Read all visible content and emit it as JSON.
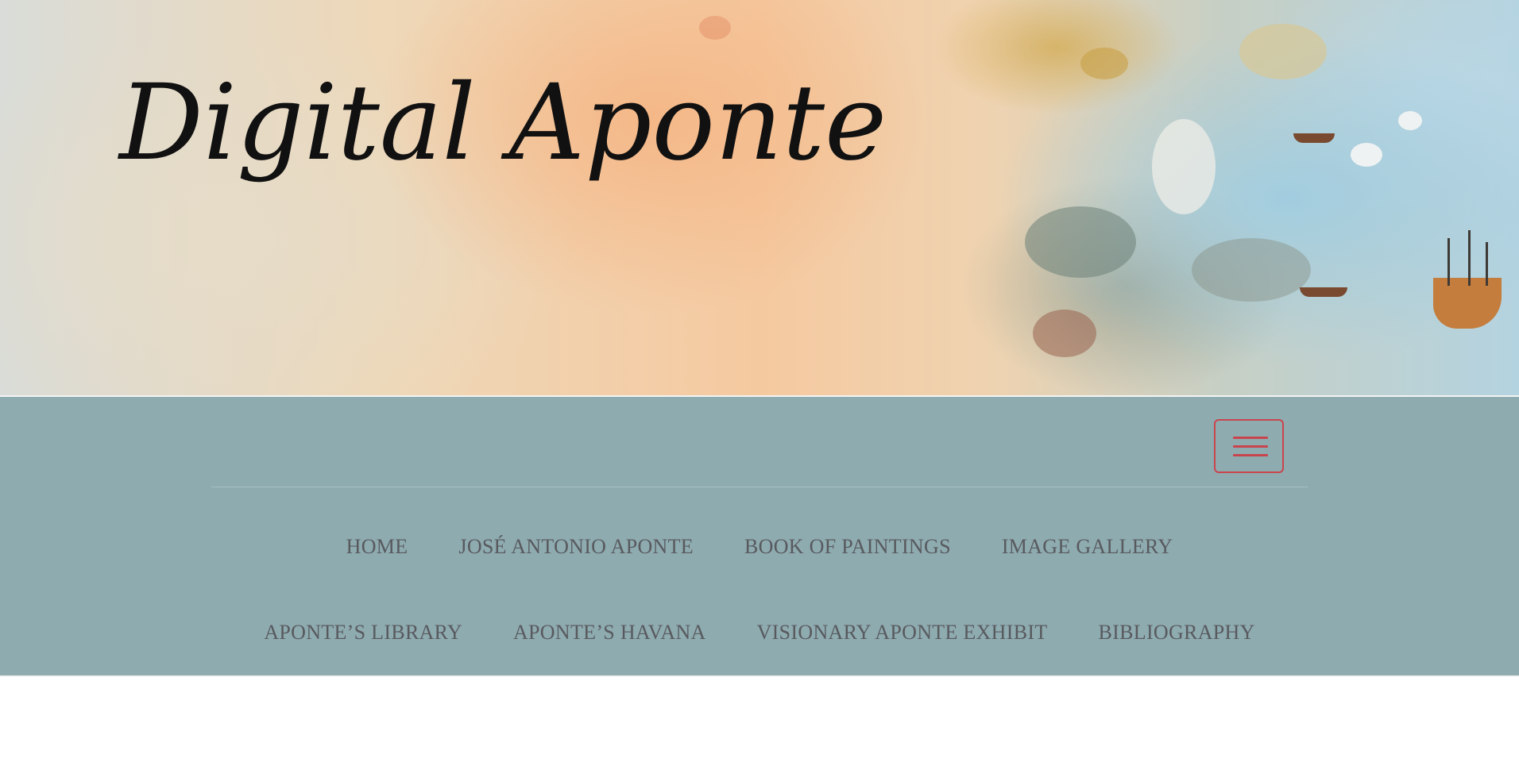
{
  "header": {
    "site_title": "Digital Aponte"
  },
  "navbar": {
    "toggle_icon": "hamburger-menu-icon",
    "accent_color": "#c9454d",
    "background_color": "#8eabb0",
    "link_color": "#585a5e",
    "links_row1": [
      {
        "label": "HOME"
      },
      {
        "label": "JOSÉ ANTONIO APONTE"
      },
      {
        "label": "BOOK OF PAINTINGS"
      },
      {
        "label": "IMAGE GALLERY"
      }
    ],
    "links_row2": [
      {
        "label": "APONTE’S LIBRARY"
      },
      {
        "label": "APONTE’S HAVANA"
      },
      {
        "label": "VISIONARY APONTE EXHIBIT"
      },
      {
        "label": "BIBLIOGRAPHY"
      }
    ]
  }
}
